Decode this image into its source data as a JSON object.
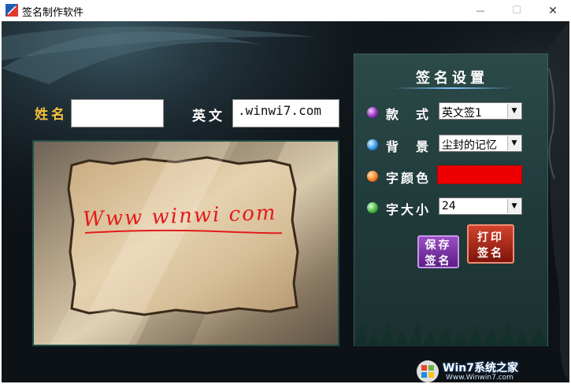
{
  "window": {
    "title": "签名制作软件",
    "minimize_glyph": "—",
    "maximize_glyph": "☐",
    "close_glyph": "✕"
  },
  "form": {
    "name_label": "姓名",
    "name_value": "",
    "english_label": "英文",
    "english_value": ".winwi7.com"
  },
  "preview": {
    "signature_text": "Www winwi com",
    "signature_color": "#e31b1b"
  },
  "settings": {
    "title": "签名设置",
    "style_label": "款　式",
    "style_value": "英文签1",
    "background_label": "背　景",
    "background_value": "尘封的记忆",
    "color_label": "字颜色",
    "color_value": "#ee0000",
    "size_label": "字大小",
    "size_value": "24",
    "save_button": {
      "line1": "保存",
      "line2": "签名"
    },
    "print_button": {
      "line1": "打印",
      "line2": "签名"
    }
  },
  "watermark": {
    "text": "Win7系统之家",
    "url": "Www.Winwin7.com"
  },
  "icons": [
    "app-icon",
    "minimize-icon",
    "maximize-icon",
    "close-icon",
    "purple-ball-icon",
    "blue-ball-icon",
    "orange-ball-icon",
    "green-ball-icon",
    "dropdown-arrow-icon",
    "windows-logo-icon"
  ]
}
